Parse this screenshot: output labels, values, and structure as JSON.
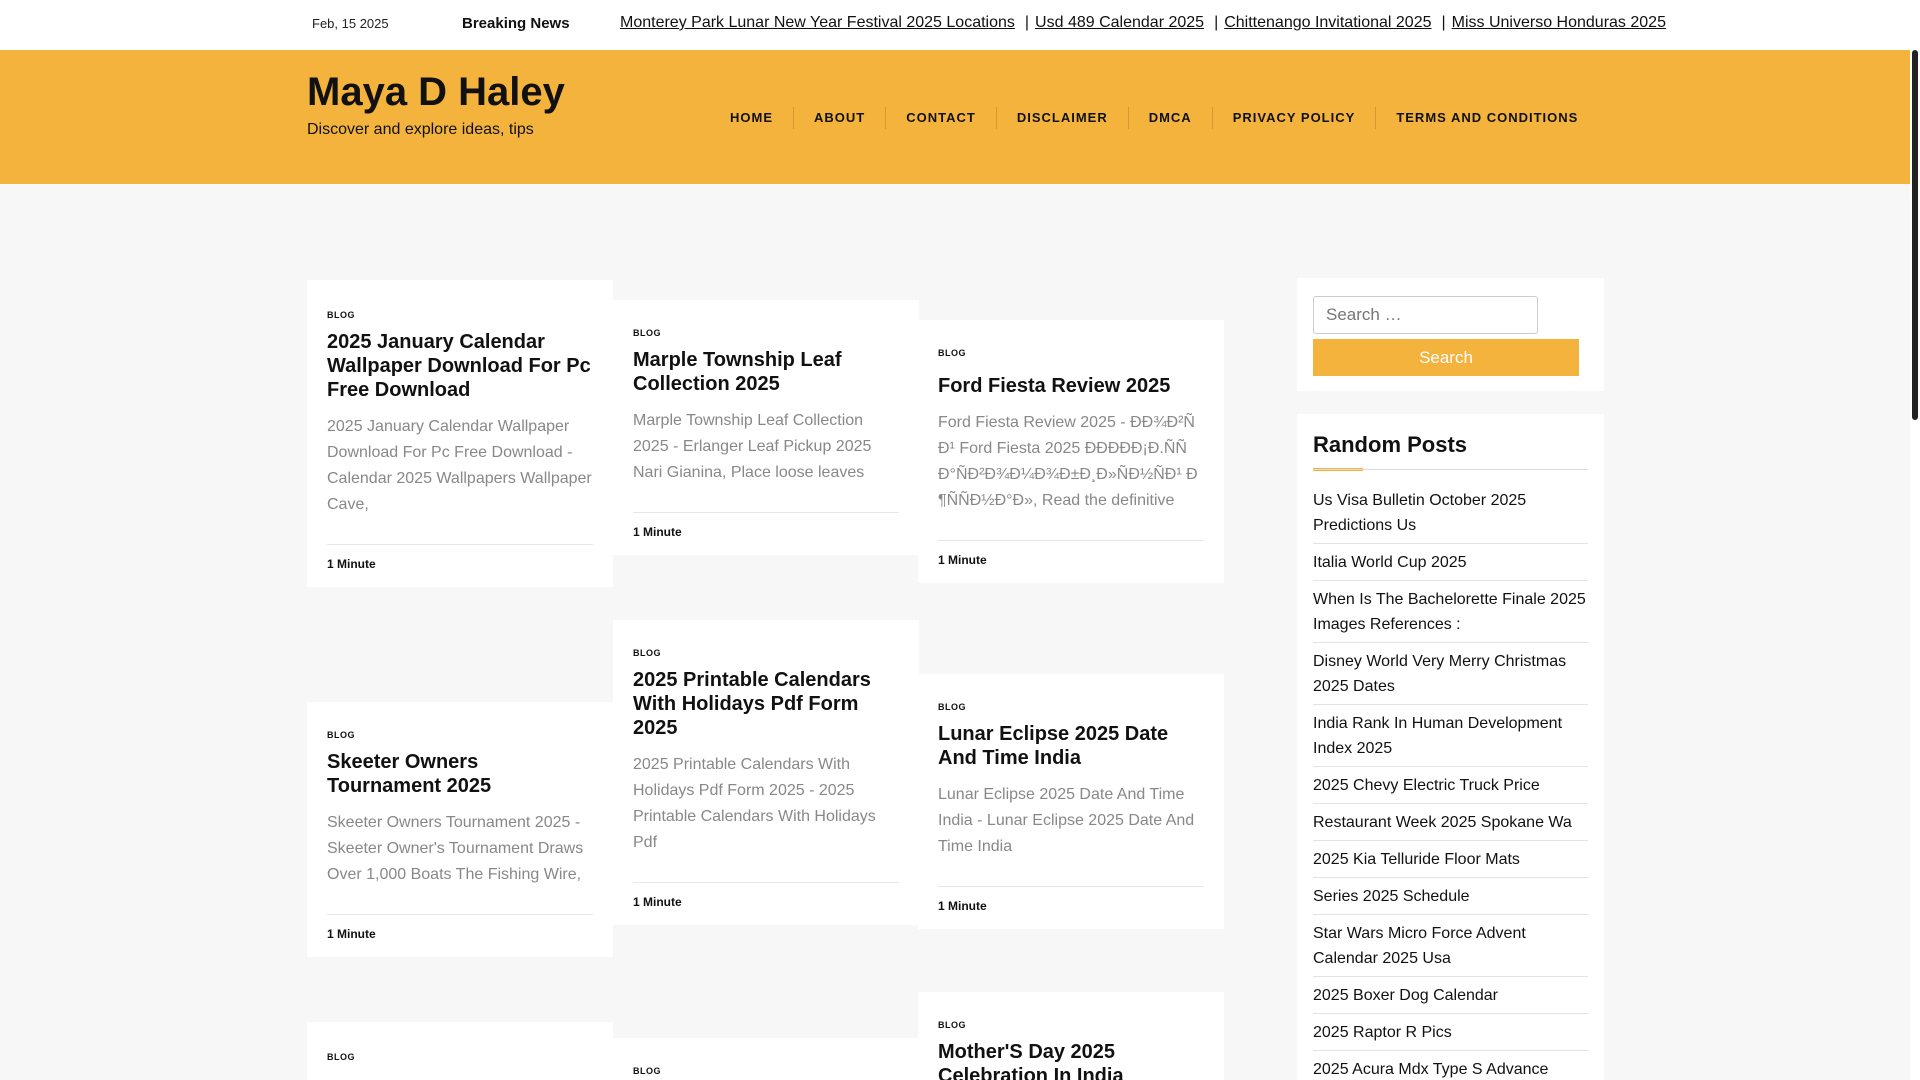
{
  "topbar": {
    "date": "Feb, 15 2025",
    "breaking_label": "Breaking News",
    "ticker": [
      "Monterey Park Lunar New Year Festival 2025 Locations",
      "Usd 489 Calendar 2025",
      "Chittenango Invitational 2025",
      "Miss Universo Honduras 2025"
    ],
    "separator": "|"
  },
  "header": {
    "site_title": "Maya D Haley",
    "tagline": "Discover and explore ideas, tips",
    "nav": [
      "HOME",
      "ABOUT",
      "CONTACT",
      "DISCLAIMER",
      "DMCA",
      "PRIVACY POLICY",
      "TERMS AND CONDITIONS"
    ]
  },
  "posts": [
    {
      "category": "BLOG",
      "title": "2025 January Calendar Wallpaper Download For Pc Free Download",
      "excerpt": "2025 January Calendar Wallpaper Download For Pc Free Download - Calendar 2025 Wallpapers Wallpaper Cave,",
      "read_time": "1 Minute"
    },
    {
      "category": "BLOG",
      "title": "Marple Township Leaf Collection 2025",
      "excerpt": "Marple Township Leaf Collection 2025 - Erlanger Leaf Pickup 2025 Nari Gianina, Place loose leaves",
      "read_time": "1 Minute"
    },
    {
      "category": "BLOG",
      "title": "Ford Fiesta Review 2025",
      "excerpt": "Ford Fiesta Review 2025 - ÐÐ¾Ð²ÑÐ¹ Ford Fiesta 2025 ÐÐÐÐÐ¡Ð.ÑÑ Ð°ÑÐ²Ð¾Ð¼Ð¾Ð±Ð¸Ð»ÑÐ½ÑÐ¹ Ð¶ÑÑÐ½Ð°Ð», Read the definitive",
      "read_time": "1 Minute"
    },
    {
      "category": "BLOG",
      "title": "Skeeter Owners Tournament 2025",
      "excerpt": "Skeeter Owners Tournament 2025 - Skeeter Owner's Tournament Draws Over 1,000 Boats The Fishing Wire,",
      "read_time": "1 Minute"
    },
    {
      "category": "BLOG",
      "title": "2025 Printable Calendars With Holidays Pdf Form 2025",
      "excerpt": "2025 Printable Calendars With Holidays Pdf Form 2025 - 2025 Printable Calendars With Holidays Pdf",
      "read_time": "1 Minute"
    },
    {
      "category": "BLOG",
      "title": "Lunar Eclipse 2025 Date And Time India",
      "excerpt": "Lunar Eclipse 2025 Date And Time India - Lunar Eclipse 2025 Date And Time India",
      "read_time": "1 Minute"
    },
    {
      "category": "BLOG",
      "title": "",
      "excerpt": "",
      "read_time": ""
    },
    {
      "category": "BLOG",
      "title": "",
      "excerpt": "",
      "read_time": ""
    },
    {
      "category": "BLOG",
      "title": "Mother'S Day 2025 Celebration In India",
      "excerpt": "",
      "read_time": ""
    }
  ],
  "sidebar": {
    "search": {
      "placeholder": "Search …",
      "button_label": "Search"
    },
    "random_posts": {
      "title": "Random Posts",
      "items": [
        "Us Visa Bulletin October 2025 Predictions Us",
        "Italia World Cup 2025",
        "When Is The Bachelorette Finale 2025 Images References :",
        "Disney World Very Merry Christmas 2025 Dates",
        "India Rank In Human Development Index 2025",
        "2025 Chevy Electric Truck Price",
        "Restaurant Week 2025 Spokane Wa",
        "2025 Kia Telluride Floor Mats",
        "Series 2025 Schedule",
        "Star Wars Micro Force Advent Calendar 2025 Usa",
        "2025 Boxer Dog Calendar",
        "2025 Raptor R Pics",
        "2025 Acura Mdx Type S Advance"
      ]
    }
  },
  "colors": {
    "accent": "#f3b33d",
    "background": "#f7f7f7",
    "excerpt_text": "#888888"
  }
}
